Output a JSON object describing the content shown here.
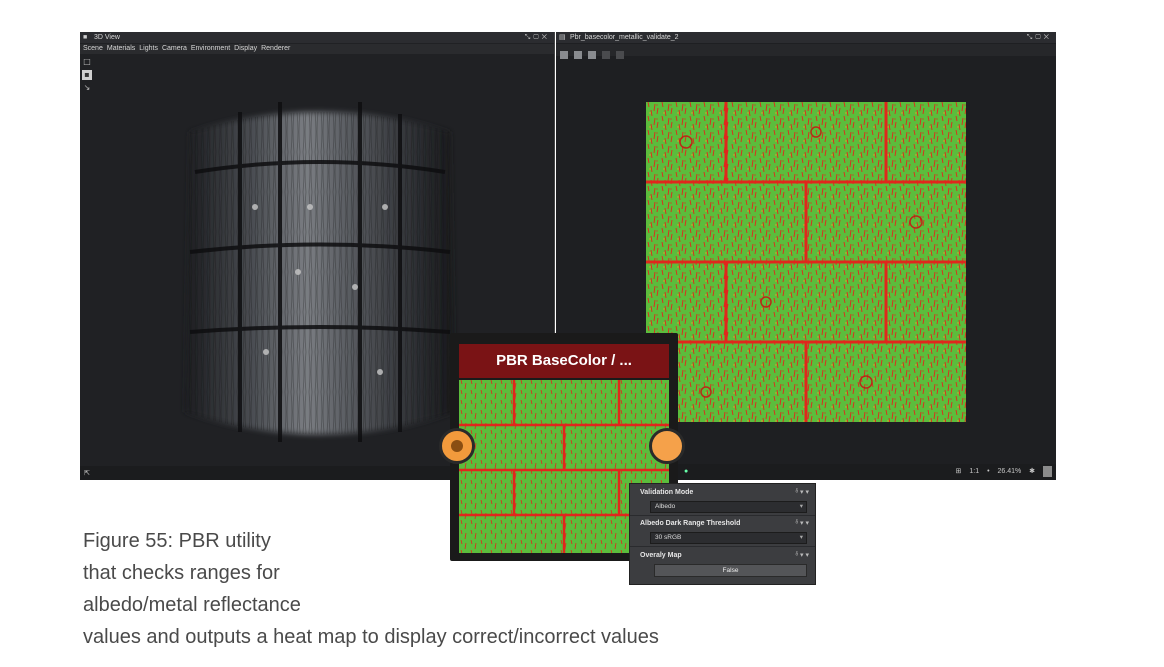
{
  "view3d": {
    "title": "3D View",
    "menu": [
      "Scene",
      "Materials",
      "Lights",
      "Camera",
      "Environment",
      "Display",
      "Renderer"
    ]
  },
  "view2d": {
    "title": "Pbr_basecolor_metallic_validate_2",
    "status": {
      "ratio": "1:1",
      "zoom": "26.41%"
    }
  },
  "node": {
    "title": "PBR BaseColor / ..."
  },
  "params": {
    "validation_mode": {
      "label": "Validation Mode",
      "value": "Albedo"
    },
    "dark_range": {
      "label": "Albedo Dark Range Threshold",
      "value": "30 sRGB"
    },
    "overlay_map": {
      "label": "Overaly Map",
      "value": "False"
    }
  },
  "caption": {
    "line1": "Figure 55: PBR utility",
    "line2": "that checks ranges for",
    "line3": "albedo/metal reflectance",
    "line4": "values and outputs a heat map to display correct/incorrect values"
  },
  "colors": {
    "valid_green": "#5bbd3c",
    "invalid_red": "#e0271c",
    "node_header": "#7a1315",
    "port_orange": "#f29a3c"
  }
}
